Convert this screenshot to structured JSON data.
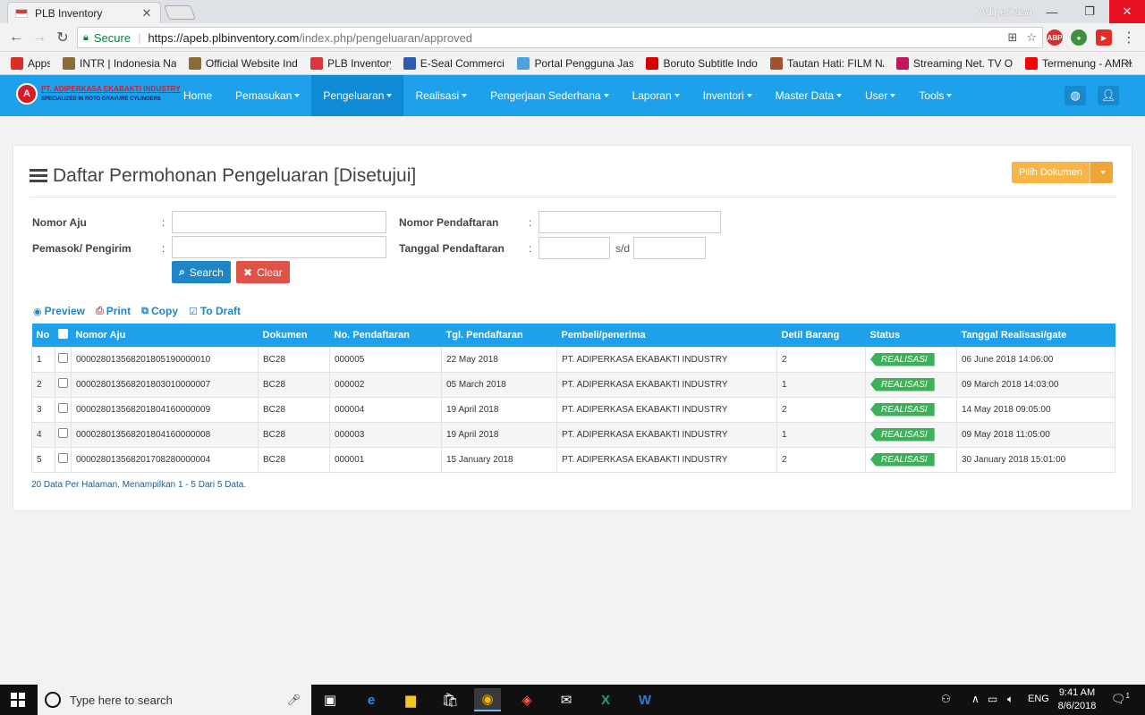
{
  "browser": {
    "tab_title": "PLB Inventory",
    "user": "Adiperkasa",
    "secure_label": "Secure",
    "url_host": "https://apeb.plbinventory.com",
    "url_path": "/index.php/pengeluaran/approved",
    "bookmarks": [
      {
        "label": "Apps",
        "icon": "apps-grid-icon",
        "color": "#d93025"
      },
      {
        "label": "INTR | Indonesia Nati",
        "icon": "garuda-icon",
        "color": "#8b6b3a"
      },
      {
        "label": "Official Website Indo",
        "icon": "garuda-icon",
        "color": "#8b6b3a"
      },
      {
        "label": "PLB Inventory",
        "icon": "flag-icon",
        "color": "#d9363e"
      },
      {
        "label": "E-Seal Commercia",
        "icon": "eseal-icon",
        "color": "#2a5db0"
      },
      {
        "label": "Portal Pengguna Jasa",
        "icon": "bird-icon",
        "color": "#4aa3df"
      },
      {
        "label": "Boruto Subtitle Indon",
        "icon": "s-logo-icon",
        "color": "#d50000"
      },
      {
        "label": "Tautan Hati: FILM NA",
        "icon": "film-icon",
        "color": "#a0522d"
      },
      {
        "label": "Streaming Net. TV On",
        "icon": "s-swirl-icon",
        "color": "#c2185b"
      },
      {
        "label": "Termenung - AMRIZ",
        "icon": "youtube-icon",
        "color": "#ff0000"
      }
    ],
    "bookmarks_more": "»"
  },
  "app": {
    "logo_line1": "PT. ADIPERKASA EKABAKTI INDUSTRY",
    "logo_line2": "SPECIALIZED IN ROTO GRAVURE CYLINDERS",
    "logo_mark": "A",
    "menu": [
      {
        "label": "Home",
        "caret": false,
        "active": false
      },
      {
        "label": "Pemasukan",
        "caret": true,
        "active": false
      },
      {
        "label": "Pengeluaran",
        "caret": true,
        "active": true
      },
      {
        "label": "Realisasi",
        "caret": true,
        "active": false
      },
      {
        "label": "Pengerjaan Sederhana",
        "caret": true,
        "active": false
      },
      {
        "label": "Laporan",
        "caret": true,
        "active": false
      },
      {
        "label": "Inventori",
        "caret": true,
        "active": false
      },
      {
        "label": "Master Data",
        "caret": true,
        "active": false
      },
      {
        "label": "User",
        "caret": true,
        "active": false
      },
      {
        "label": "Tools",
        "caret": true,
        "active": false
      }
    ]
  },
  "page": {
    "title": "Daftar Permohonan Pengeluaran [Disetujui]",
    "pilih_dokumen": "Pilih Dokumen",
    "filters": {
      "nomor_aju_label": "Nomor Aju",
      "pemasok_label": "Pemasok/ Pengirim",
      "nomor_pendaftaran_label": "Nomor Pendaftaran",
      "tanggal_pendaftaran_label": "Tanggal Pendaftaran",
      "colon": ":",
      "sd": "s/d",
      "nomor_aju_value": "",
      "pemasok_value": "",
      "nomor_pendaftaran_value": "",
      "tanggal_from_value": "",
      "tanggal_to_value": ""
    },
    "search_label": "Search",
    "clear_label": "Clear",
    "actions": {
      "preview": "Preview",
      "print": "Print",
      "copy": "Copy",
      "to_draft": "To Draft"
    },
    "table": {
      "headers": [
        "No",
        "",
        "Nomor Aju",
        "Dokumen",
        "No. Pendaftaran",
        "Tgl. Pendaftaran",
        "Pembeli/penerima",
        "Detil Barang",
        "Status",
        "Tanggal Realisasi/gate"
      ],
      "rows": [
        {
          "no": "1",
          "nomor_aju": "000028013568201805190000010",
          "dokumen": "BC28",
          "no_pendaftaran": "000005",
          "tgl": "22 May 2018",
          "pembeli": "PT. ADIPERKASA EKABAKTI INDUSTRY",
          "detil": "2",
          "status": "REALISASI",
          "realisasi": "06 June 2018 14:06:00"
        },
        {
          "no": "2",
          "nomor_aju": "000028013568201803010000007",
          "dokumen": "BC28",
          "no_pendaftaran": "000002",
          "tgl": "05 March 2018",
          "pembeli": "PT. ADIPERKASA EKABAKTI INDUSTRY",
          "detil": "1",
          "status": "REALISASI",
          "realisasi": "09 March 2018 14:03:00"
        },
        {
          "no": "3",
          "nomor_aju": "000028013568201804160000009",
          "dokumen": "BC28",
          "no_pendaftaran": "000004",
          "tgl": "19 April 2018",
          "pembeli": "PT. ADIPERKASA EKABAKTI INDUSTRY",
          "detil": "2",
          "status": "REALISASI",
          "realisasi": "14 May 2018 09:05:00"
        },
        {
          "no": "4",
          "nomor_aju": "000028013568201804160000008",
          "dokumen": "BC28",
          "no_pendaftaran": "000003",
          "tgl": "19 April 2018",
          "pembeli": "PT. ADIPERKASA EKABAKTI INDUSTRY",
          "detil": "1",
          "status": "REALISASI",
          "realisasi": "09 May 2018 11:05:00"
        },
        {
          "no": "5",
          "nomor_aju": "000028013568201708280000004",
          "dokumen": "BC28",
          "no_pendaftaran": "000001",
          "tgl": "15 January 2018",
          "pembeli": "PT. ADIPERKASA EKABAKTI INDUSTRY",
          "detil": "2",
          "status": "REALISASI",
          "realisasi": "30 January 2018 15:01:00"
        }
      ]
    },
    "pager_text": "20 Data Per Halaman. Menampilkan 1 - 5 Dari 5 Data."
  },
  "taskbar": {
    "search_placeholder": "Type here to search",
    "lang": "ENG",
    "time": "9:41 AM",
    "date": "8/6/2018",
    "notification_count": "1"
  },
  "colors": {
    "navbar": "#1ea0ea",
    "search_button": "#1e86c8",
    "clear_button": "#e05247",
    "pilih_button": "#f9b548",
    "status_badge": "#3bb257"
  }
}
